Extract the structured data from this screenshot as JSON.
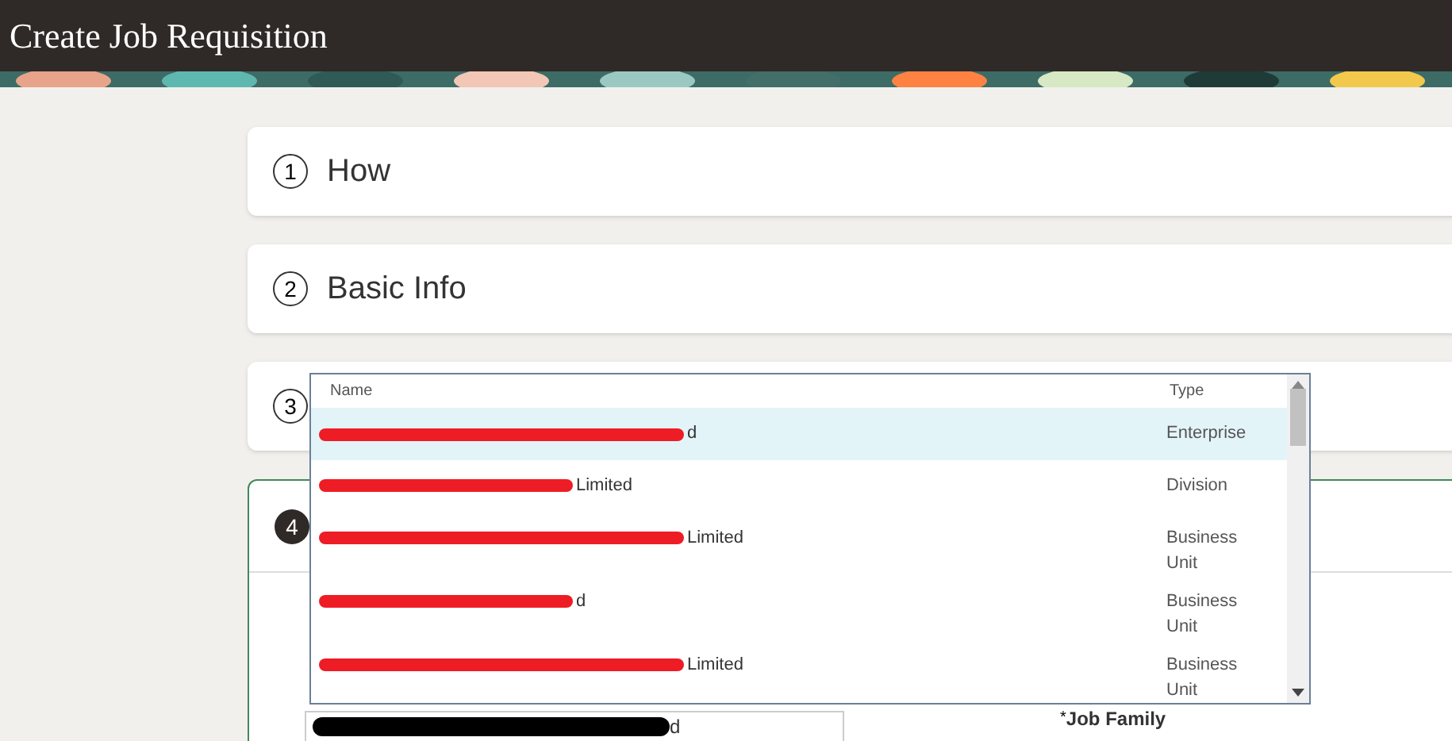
{
  "header": {
    "title": "Create Job Requisition"
  },
  "steps": [
    {
      "number": "1",
      "label": "How",
      "kind": "closed"
    },
    {
      "number": "2",
      "label": "Basic Info",
      "kind": "closed"
    },
    {
      "number": "3",
      "kind": "closed"
    },
    {
      "number": "4",
      "kind": "current"
    }
  ],
  "dropdown": {
    "columns": [
      "Name",
      "Type"
    ],
    "rows": [
      {
        "name_visible": "d",
        "type": "Enterprise",
        "selected": true
      },
      {
        "name_visible": "Limited",
        "type": "Division",
        "selected": false
      },
      {
        "name_visible": "Limited",
        "type": "Business Unit",
        "selected": false
      },
      {
        "name_visible": "d",
        "type": "Business Unit",
        "selected": false
      },
      {
        "name_visible": "Limited",
        "type": "Business Unit",
        "selected": false
      }
    ]
  },
  "form": {
    "value_visible": "d",
    "job_family_label": "Job Family",
    "required_mark": "*"
  }
}
